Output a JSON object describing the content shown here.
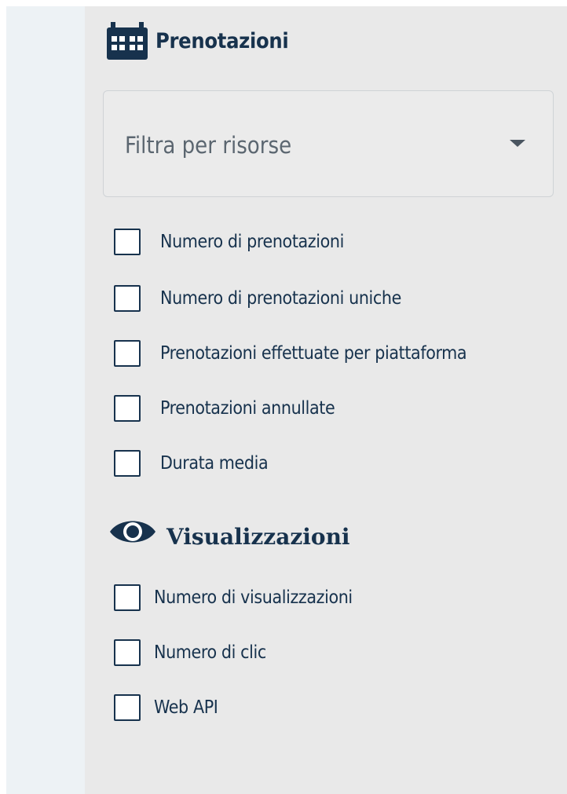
{
  "prenotazioni": {
    "title": "Prenotazioni",
    "icon": "calendar-icon",
    "filter": {
      "placeholder": "Filtra per risorse"
    },
    "options": [
      "Numero di prenotazioni",
      "Numero di prenotazioni uniche",
      "Prenotazioni effettuate per piattaforma",
      "Prenotazioni annullate",
      "Durata media"
    ]
  },
  "visualizzazioni": {
    "title": "Visualizzazioni",
    "icon": "eye-icon",
    "options": [
      "Numero di visualizzazioni",
      "Numero di clic",
      "Web API"
    ]
  },
  "colors": {
    "text": "#17324d",
    "panel_background": "#e9e9e9",
    "left_panel_background": "#edf2f5",
    "checkbox_border": "#17324d"
  }
}
